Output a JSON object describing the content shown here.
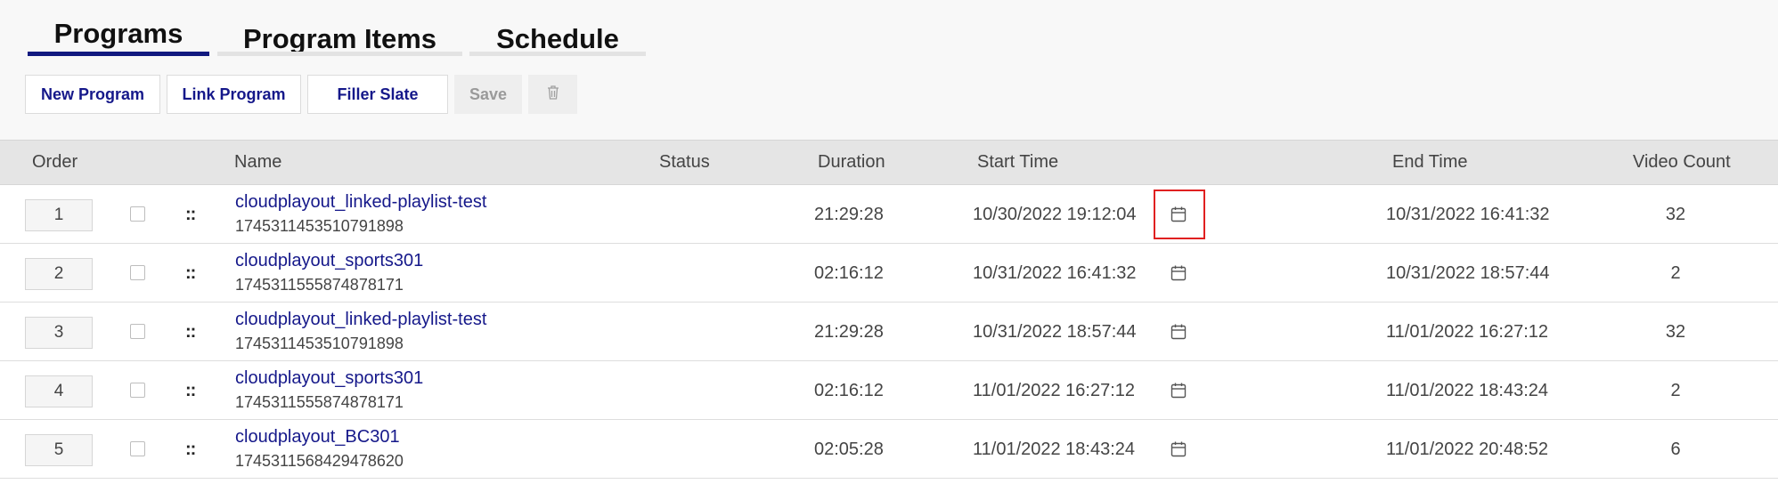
{
  "tabs": [
    {
      "label": "Programs",
      "active": true
    },
    {
      "label": "Program Items",
      "active": false
    },
    {
      "label": "Schedule",
      "active": false
    }
  ],
  "toolbar": {
    "new_program": "New Program",
    "link_program": "Link Program",
    "filler_slate": "Filler Slate",
    "save": "Save",
    "delete_icon": "trash-icon"
  },
  "table": {
    "headers": {
      "order": "Order",
      "name": "Name",
      "status": "Status",
      "duration": "Duration",
      "start_time": "Start Time",
      "end_time": "End Time",
      "video_count": "Video Count"
    },
    "rows": [
      {
        "order": "1",
        "name": "cloudplayout_linked-playlist-test",
        "id": "1745311453510791898",
        "duration": "21:29:28",
        "start": "10/30/2022 19:12:04",
        "end": "10/31/2022 16:41:32",
        "video_count": "32",
        "calendar_highlighted": true
      },
      {
        "order": "2",
        "name": "cloudplayout_sports301",
        "id": "1745311555874878171",
        "duration": "02:16:12",
        "start": "10/31/2022 16:41:32",
        "end": "10/31/2022 18:57:44",
        "video_count": "2",
        "calendar_highlighted": false
      },
      {
        "order": "3",
        "name": "cloudplayout_linked-playlist-test",
        "id": "1745311453510791898",
        "duration": "21:29:28",
        "start": "10/31/2022 18:57:44",
        "end": "11/01/2022 16:27:12",
        "video_count": "32",
        "calendar_highlighted": false
      },
      {
        "order": "4",
        "name": "cloudplayout_sports301",
        "id": "1745311555874878171",
        "duration": "02:16:12",
        "start": "11/01/2022 16:27:12",
        "end": "11/01/2022 18:43:24",
        "video_count": "2",
        "calendar_highlighted": false
      },
      {
        "order": "5",
        "name": "cloudplayout_BC301",
        "id": "1745311568429478620",
        "duration": "02:05:28",
        "start": "11/01/2022 18:43:24",
        "end": "11/01/2022 20:48:52",
        "video_count": "6",
        "calendar_highlighted": false
      }
    ]
  },
  "colors": {
    "accent": "#121a80",
    "link": "#15188a",
    "highlight": "#e02020"
  },
  "icons": {
    "drag_handle": "::",
    "calendar": "calendar-icon"
  }
}
